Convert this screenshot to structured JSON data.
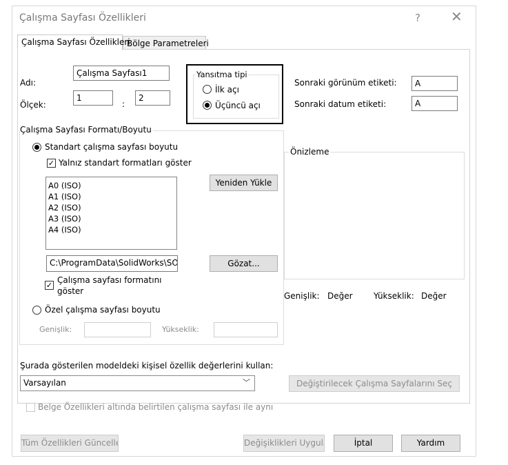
{
  "window": {
    "title": "Çalışma Sayfası Özellikleri",
    "help_glyph": "?",
    "close_glyph": "✕"
  },
  "tabs": [
    {
      "label": "Çalışma Sayfası Özellikleri",
      "active": true
    },
    {
      "label": "Bölge Parametreleri",
      "active": false
    }
  ],
  "name": {
    "label": "Adı:",
    "value": "Çalışma Sayfası1"
  },
  "scale": {
    "label": "Ölçek:",
    "left": "1",
    "separator": ":",
    "right": "2"
  },
  "projection": {
    "title": "Yansıtma tipi",
    "options": [
      {
        "label": "İlk açı",
        "selected": false
      },
      {
        "label": "Üçüncü açı",
        "selected": true
      }
    ]
  },
  "next_view_label": {
    "label": "Sonraki görünüm etiketi:",
    "value": "A"
  },
  "next_datum_label": {
    "label": "Sonraki datum etiketi:",
    "value": "A"
  },
  "sheet_format": {
    "group_title": "Çalışma Sayfası Formatı/Boyutu",
    "standard_radio": {
      "label": "Standart çalışma sayfası boyutu",
      "selected": true
    },
    "only_standard_check": {
      "label": "Yalnız standart formatları göster",
      "checked": true
    },
    "sizes": [
      "A0 (ISO)",
      "A1 (ISO)",
      "A2 (ISO)",
      "A3 (ISO)",
      "A4 (ISO)"
    ],
    "reload_button": "Yeniden Yükle",
    "path_value": "C:\\ProgramData\\SolidWorks\\SOL",
    "browse_button": "Gözat...",
    "show_format_check": {
      "label_line1": "Çalışma sayfası formatını",
      "label_line2": "göster",
      "checked": true
    },
    "custom_radio": {
      "label": "Özel çalışma sayfası boyutu",
      "selected": false
    },
    "width_label": "Genişlik:",
    "height_label": "Yükseklik:"
  },
  "preview": {
    "title": "Önizleme",
    "width_label": "Genişlik:",
    "width_value": "Değer",
    "height_label": "Yükseklik:",
    "height_value": "Değer"
  },
  "property_source": {
    "label": "Şurada gösterilen modeldeki kişisel özellik değerlerini kullan:",
    "selected": "Varsayılan",
    "select_sheets_button": "Değiştirilecek Çalışma Sayfalarını Seç",
    "same_sheet_check": {
      "label": "Belge Özellikleri altında belirtilen çalışma sayfası ile aynı",
      "checked": false
    }
  },
  "footer": {
    "update_all": "Tüm Özellikleri Güncelle",
    "apply": "Değişiklikleri Uygula",
    "cancel": "İptal",
    "help": "Yardım"
  },
  "colors": {
    "highlight_border": "#000000",
    "disabled_text": "#8c8c8c",
    "title_text": "#777777"
  }
}
